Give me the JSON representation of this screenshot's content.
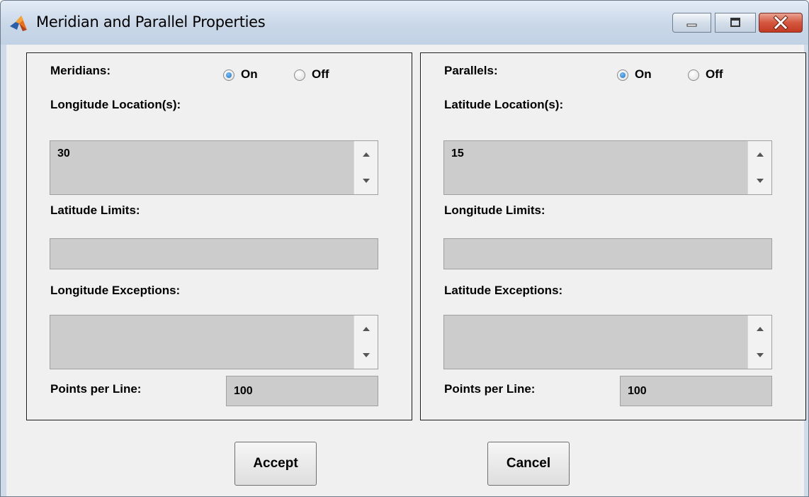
{
  "window": {
    "title": "Meridian and Parallel Properties"
  },
  "meridians": {
    "header": "Meridians:",
    "on_label": "On",
    "off_label": "Off",
    "selected": "On",
    "locations_label": "Longitude Location(s):",
    "locations_value": "30",
    "limits_label": "Latitude Limits:",
    "limits_value": "",
    "exceptions_label": "Longitude Exceptions:",
    "exceptions_value": "",
    "points_label": "Points per Line:",
    "points_value": "100"
  },
  "parallels": {
    "header": "Parallels:",
    "on_label": "On",
    "off_label": "Off",
    "selected": "On",
    "locations_label": "Latitude Location(s):",
    "locations_value": "15",
    "limits_label": "Longitude Limits:",
    "limits_value": "",
    "exceptions_label": "Latitude Exceptions:",
    "exceptions_value": "",
    "points_label": "Points per Line:",
    "points_value": "100"
  },
  "buttons": {
    "accept": "Accept",
    "cancel": "Cancel"
  },
  "icons": {
    "app": "matlab-membrane-icon",
    "minimize": "minimize-icon",
    "maximize": "maximize-icon",
    "close": "close-icon",
    "scroll_up": "arrow-up-icon",
    "scroll_down": "arrow-down-icon"
  },
  "colors": {
    "titlebar": "#c9d7e8",
    "client_bg": "#f0f0f0",
    "field_bg": "#cccccc",
    "close_button": "#c94a31",
    "radio_selected": "#1c6fc2"
  }
}
